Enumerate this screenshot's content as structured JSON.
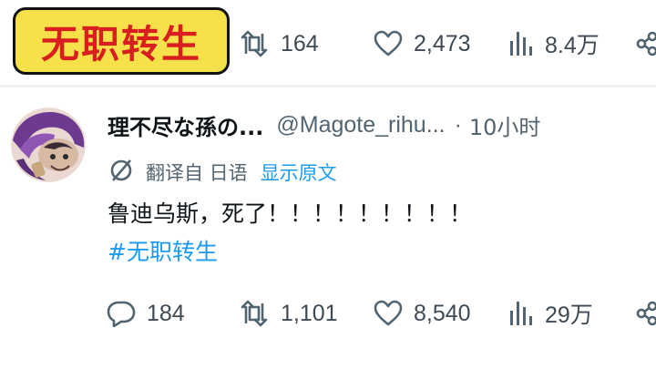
{
  "badge": {
    "text": "无职转生"
  },
  "top_stats": {
    "replies": "",
    "retweets": "164",
    "likes": "2,473",
    "views": "8.4万"
  },
  "tweet": {
    "display_name": "理不尽な孫の...",
    "handle": "@Magote_rihu...",
    "separator": "·",
    "time": "10小时",
    "translated_from": "翻译自 日语",
    "show_original": "显示原文",
    "text": "鲁迪乌斯，死了！！！！！！！！！",
    "hashtag": "#无职转生"
  },
  "stats": {
    "replies": "184",
    "retweets": "1,101",
    "likes": "8,540",
    "views": "29万"
  },
  "icons": {
    "reply": "reply-icon",
    "retweet": "retweet-icon",
    "like": "heart-icon",
    "views": "views-icon",
    "share": "share-icon",
    "translate": "translate-icon"
  },
  "colors": {
    "badge_bg": "#f7e14a",
    "badge_text": "#d81e1e",
    "link": "#1d9bf0",
    "muted": "#536471"
  }
}
